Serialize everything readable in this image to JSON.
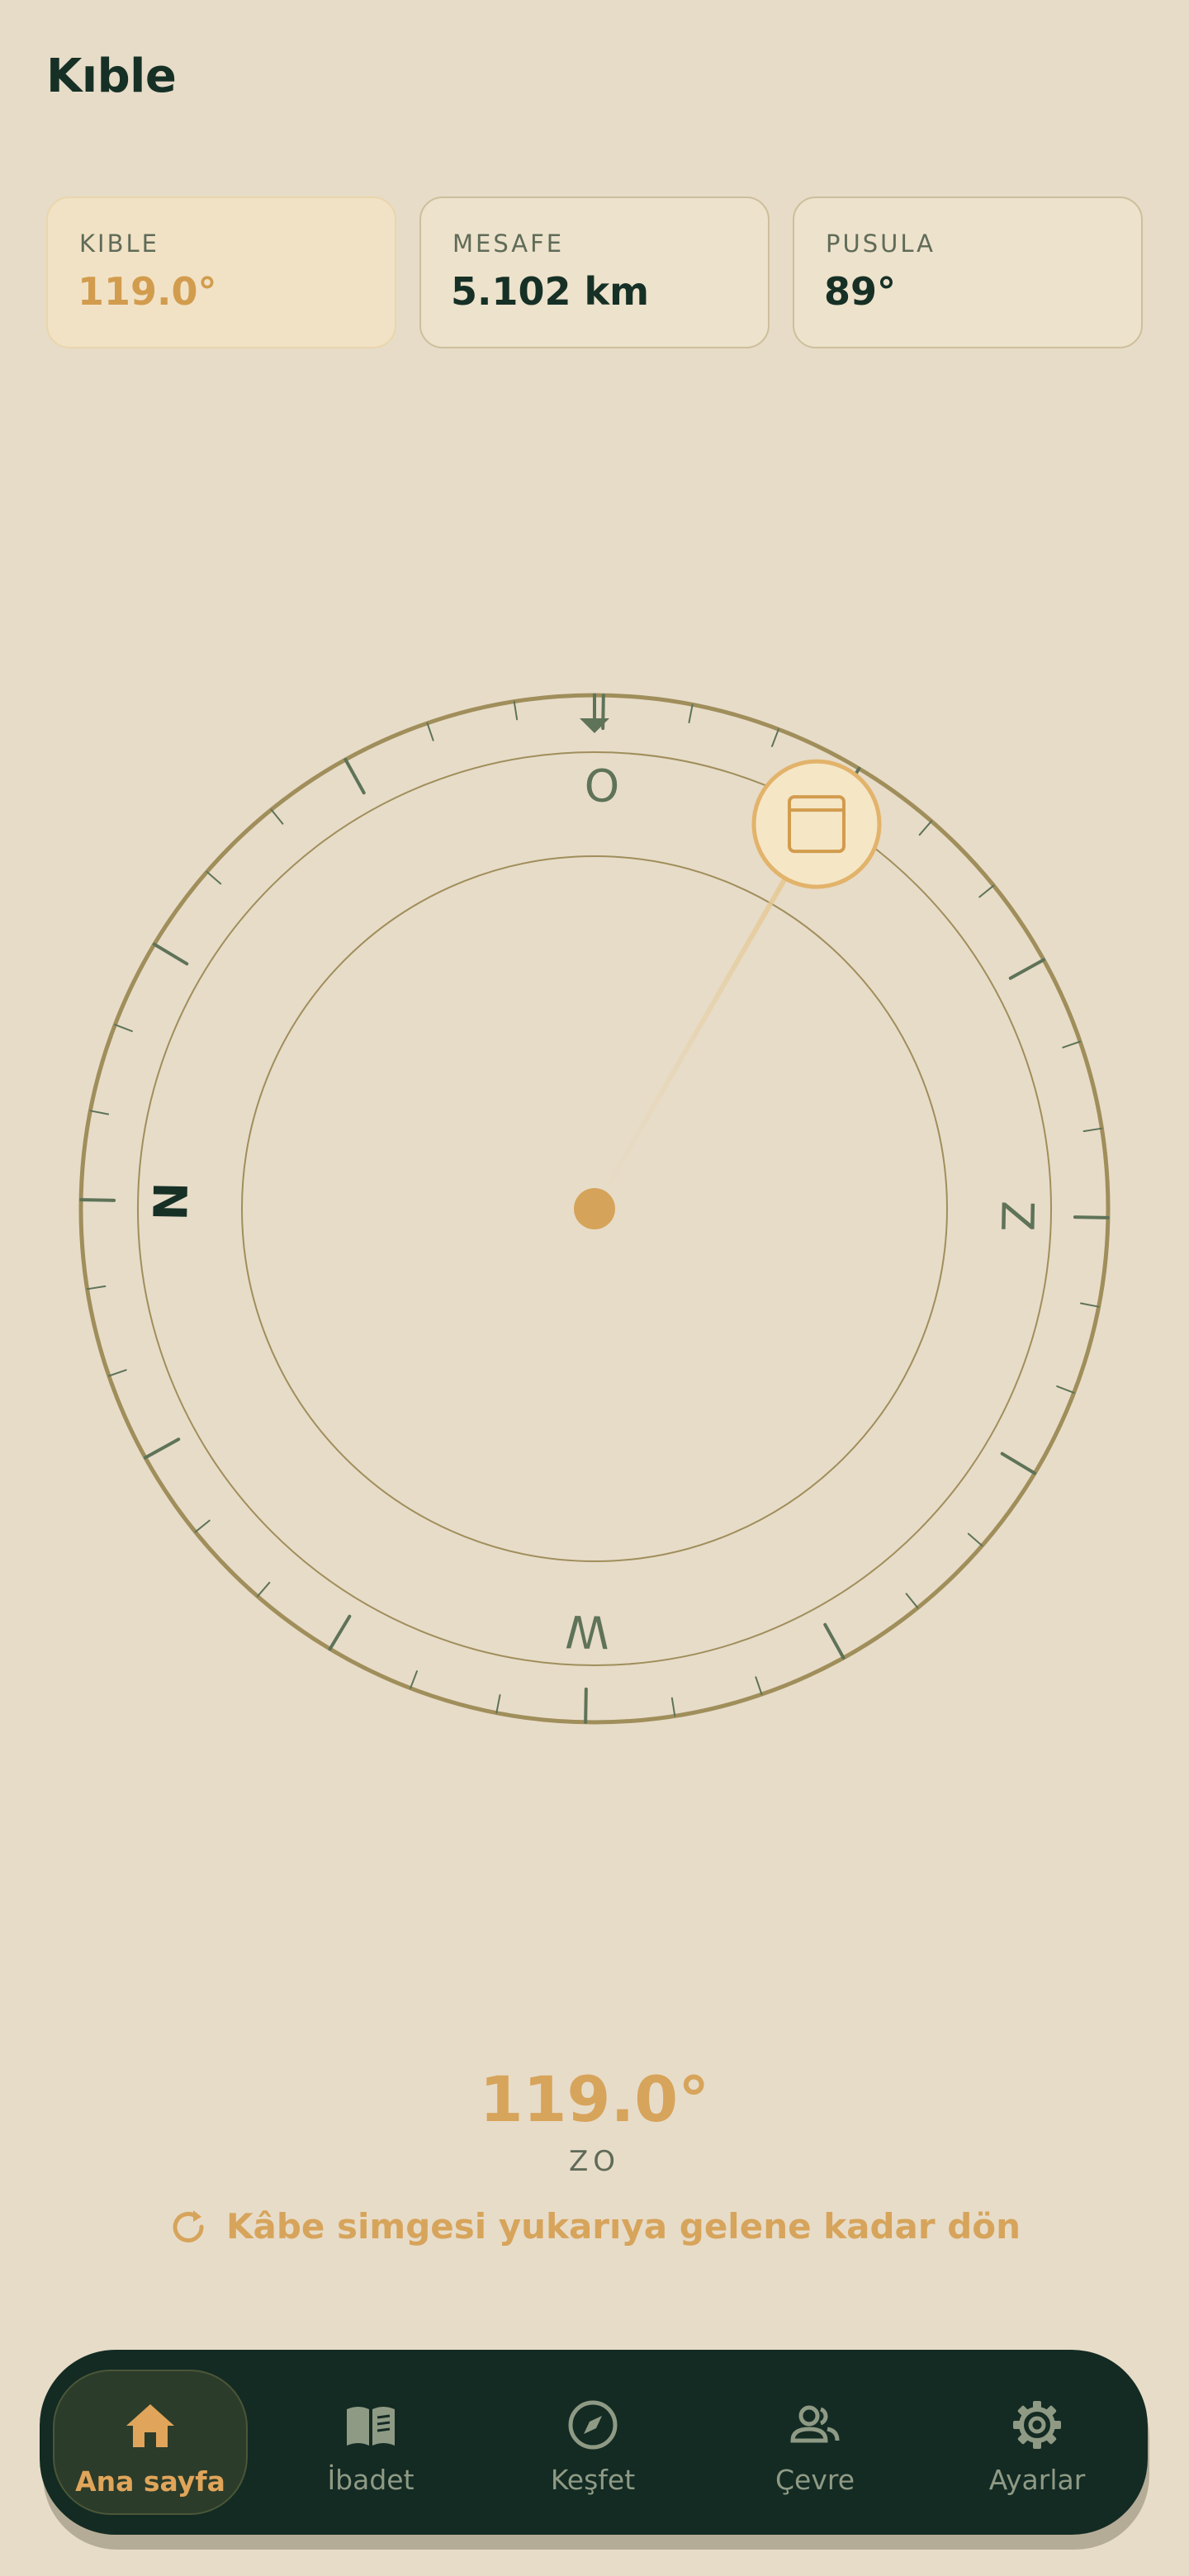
{
  "header": {
    "title": "Kıble"
  },
  "cards": [
    {
      "label": "KIBLE",
      "value": "119.0°"
    },
    {
      "label": "MESAFE",
      "value": "5.102 km"
    },
    {
      "label": "PUSULA",
      "value": "89°"
    }
  ],
  "compass": {
    "heading_deg": 89,
    "qibla_deg": 119.0,
    "cardinals": {
      "north": "N",
      "east": "O",
      "south": "Z",
      "west": "W"
    },
    "kaaba_icon": "kaaba-icon",
    "colors": {
      "ring": "#a08e5b",
      "accent": "#d7a45b",
      "tick": "#5e7358",
      "north": "#163026"
    }
  },
  "readout": {
    "degrees": "119.0°",
    "direction": "ZO",
    "hint": "Kâbe simgesi yukarıya gelene kadar dön",
    "hint_icon": "rotate-icon"
  },
  "nav": {
    "items": [
      {
        "label": "Ana sayfa",
        "icon": "home-icon",
        "active": true
      },
      {
        "label": "İbadet",
        "icon": "book-icon",
        "active": false
      },
      {
        "label": "Keşfet",
        "icon": "compass-icon",
        "active": false
      },
      {
        "label": "Çevre",
        "icon": "people-icon",
        "active": false
      },
      {
        "label": "Ayarlar",
        "icon": "gear-icon",
        "active": false
      }
    ],
    "colors": {
      "background": "#132b23",
      "active": "#e0a55a",
      "inactive": "#8f9a85"
    }
  }
}
